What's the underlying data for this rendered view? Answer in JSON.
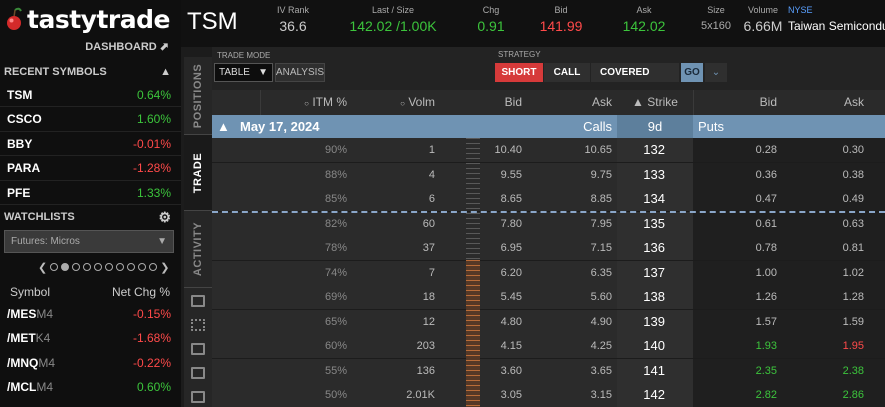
{
  "app": {
    "logo": "tastytrade",
    "dashboard_link": "DASHBOARD"
  },
  "colors": {
    "positive": "#3cc43c",
    "negative": "#ff4a4a",
    "accent_blue": "#6f93b3",
    "short_red": "#d63a3a"
  },
  "recent_symbols": {
    "title": "RECENT SYMBOLS",
    "items": [
      {
        "symbol": "TSM",
        "change": "0.64%",
        "dir": "pos"
      },
      {
        "symbol": "CSCO",
        "change": "1.60%",
        "dir": "pos"
      },
      {
        "symbol": "BBY",
        "change": "-0.01%",
        "dir": "neg"
      },
      {
        "symbol": "PARA",
        "change": "-1.28%",
        "dir": "neg"
      },
      {
        "symbol": "PFE",
        "change": "1.33%",
        "dir": "pos"
      }
    ]
  },
  "watchlists": {
    "title": "WATCHLISTS",
    "selected": "Futures: Micros",
    "col_symbol": "Symbol",
    "col_change": "Net Chg %",
    "items": [
      {
        "root": "/MES",
        "suffix": "M4",
        "change": "-0.15%",
        "dir": "neg"
      },
      {
        "root": "/MET",
        "suffix": "K4",
        "change": "-1.68%",
        "dir": "neg"
      },
      {
        "root": "/MNQ",
        "suffix": "M4",
        "change": "-0.22%",
        "dir": "neg"
      },
      {
        "root": "/MCL",
        "suffix": "M4",
        "change": "0.60%",
        "dir": "pos"
      }
    ]
  },
  "side_tabs": {
    "positions": "POSITIONS",
    "trade": "TRADE",
    "activity": "ACTIVITY"
  },
  "quote": {
    "symbol": "TSM",
    "iv_rank_label": "IV Rank",
    "iv_rank": "36.6",
    "last_size_label": "Last / Size",
    "last_size": "142.02 /1.00K",
    "chg_label": "Chg",
    "chg": "0.91",
    "bid_label": "Bid",
    "bid": "141.99",
    "ask_label": "Ask",
    "ask": "142.02",
    "size_label": "Size",
    "size": "5x160",
    "volume_label": "Volume",
    "volume": "6.66M",
    "exchange": "NYSE",
    "name": "Taiwan Semiconductor"
  },
  "toolbar": {
    "trade_mode_label": "TRADE MODE",
    "trade_mode_value": "TABLE",
    "analysis": "ANALYSIS",
    "strategy_label": "STRATEGY",
    "short": "SHORT",
    "call": "CALL",
    "covered": "COVERED",
    "go": "GO"
  },
  "chain": {
    "headers": {
      "itm": "ITM %",
      "volm": "Volm",
      "bid": "Bid",
      "ask": "Ask",
      "strike": "Strike",
      "put_bid": "Bid",
      "put_ask": "Ask"
    },
    "expiration": {
      "date": "May 17, 2024",
      "calls": "Calls",
      "dte": "9d",
      "puts": "Puts"
    },
    "rows": [
      {
        "itm": "90%",
        "volm": "1",
        "bid": "10.40",
        "ask": "10.65",
        "strike": "132",
        "put_bid": "0.28",
        "put_ask": "0.30",
        "pb": "n",
        "pa": "n"
      },
      {
        "itm": "88%",
        "volm": "4",
        "bid": "9.55",
        "ask": "9.75",
        "strike": "133",
        "put_bid": "0.36",
        "put_ask": "0.38",
        "pb": "n",
        "pa": "n"
      },
      {
        "itm": "85%",
        "volm": "6",
        "bid": "8.65",
        "ask": "8.85",
        "strike": "134",
        "put_bid": "0.47",
        "put_ask": "0.49",
        "pb": "n",
        "pa": "n"
      },
      {
        "itm": "82%",
        "volm": "60",
        "bid": "7.80",
        "ask": "7.95",
        "strike": "135",
        "put_bid": "0.61",
        "put_ask": "0.63",
        "pb": "n",
        "pa": "n"
      },
      {
        "itm": "78%",
        "volm": "37",
        "bid": "6.95",
        "ask": "7.15",
        "strike": "136",
        "put_bid": "0.78",
        "put_ask": "0.81",
        "pb": "n",
        "pa": "n"
      },
      {
        "itm": "74%",
        "volm": "7",
        "bid": "6.20",
        "ask": "6.35",
        "strike": "137",
        "put_bid": "1.00",
        "put_ask": "1.02",
        "pb": "n",
        "pa": "n"
      },
      {
        "itm": "69%",
        "volm": "18",
        "bid": "5.45",
        "ask": "5.60",
        "strike": "138",
        "put_bid": "1.26",
        "put_ask": "1.28",
        "pb": "n",
        "pa": "n"
      },
      {
        "itm": "65%",
        "volm": "12",
        "bid": "4.80",
        "ask": "4.90",
        "strike": "139",
        "put_bid": "1.57",
        "put_ask": "1.59",
        "pb": "n",
        "pa": "n"
      },
      {
        "itm": "60%",
        "volm": "203",
        "bid": "4.15",
        "ask": "4.25",
        "strike": "140",
        "put_bid": "1.93",
        "put_ask": "1.95",
        "pb": "pos",
        "pa": "neg"
      },
      {
        "itm": "55%",
        "volm": "136",
        "bid": "3.60",
        "ask": "3.65",
        "strike": "141",
        "put_bid": "2.35",
        "put_ask": "2.38",
        "pb": "pos",
        "pa": "pos"
      },
      {
        "itm": "50%",
        "volm": "2.01K",
        "bid": "3.05",
        "ask": "3.15",
        "strike": "142",
        "put_bid": "2.82",
        "put_ask": "2.86",
        "pb": "pos",
        "pa": "pos"
      }
    ]
  }
}
